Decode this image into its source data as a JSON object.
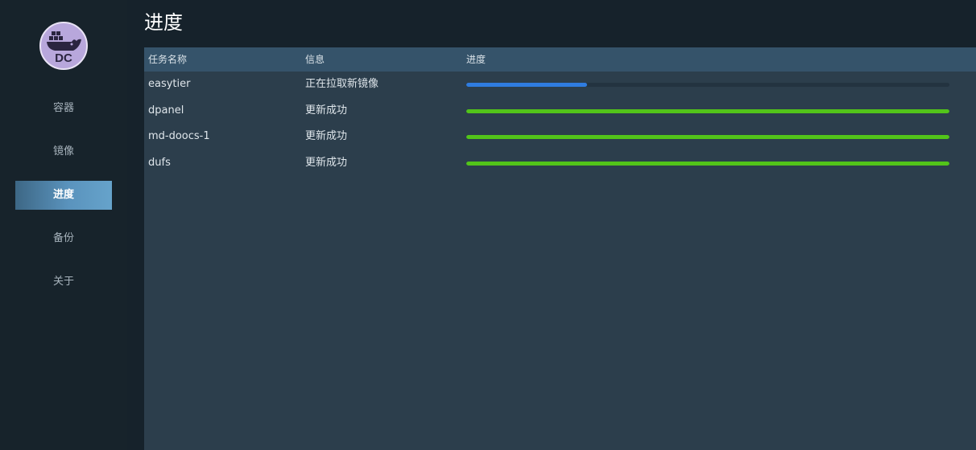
{
  "sidebar": {
    "logo_text": "DC",
    "items": [
      {
        "label": "容器",
        "active": false
      },
      {
        "label": "镜像",
        "active": false
      },
      {
        "label": "进度",
        "active": true
      },
      {
        "label": "备份",
        "active": false
      },
      {
        "label": "关于",
        "active": false
      }
    ]
  },
  "page": {
    "title": "进度"
  },
  "table": {
    "columns": [
      "任务名称",
      "信息",
      "进度"
    ],
    "rows": [
      {
        "name": "easytier",
        "info": "正在拉取新镜像",
        "progress": 0.25,
        "color": "#2f7ce0"
      },
      {
        "name": "dpanel",
        "info": "更新成功",
        "progress": 1.0,
        "color": "#52c41a"
      },
      {
        "name": "md-doocs-1",
        "info": "更新成功",
        "progress": 1.0,
        "color": "#52c41a"
      },
      {
        "name": "dufs",
        "info": "更新成功",
        "progress": 1.0,
        "color": "#52c41a"
      }
    ]
  },
  "colors": {
    "accent": "#5a93bd",
    "success": "#52c41a",
    "in_progress": "#2f7ce0"
  }
}
